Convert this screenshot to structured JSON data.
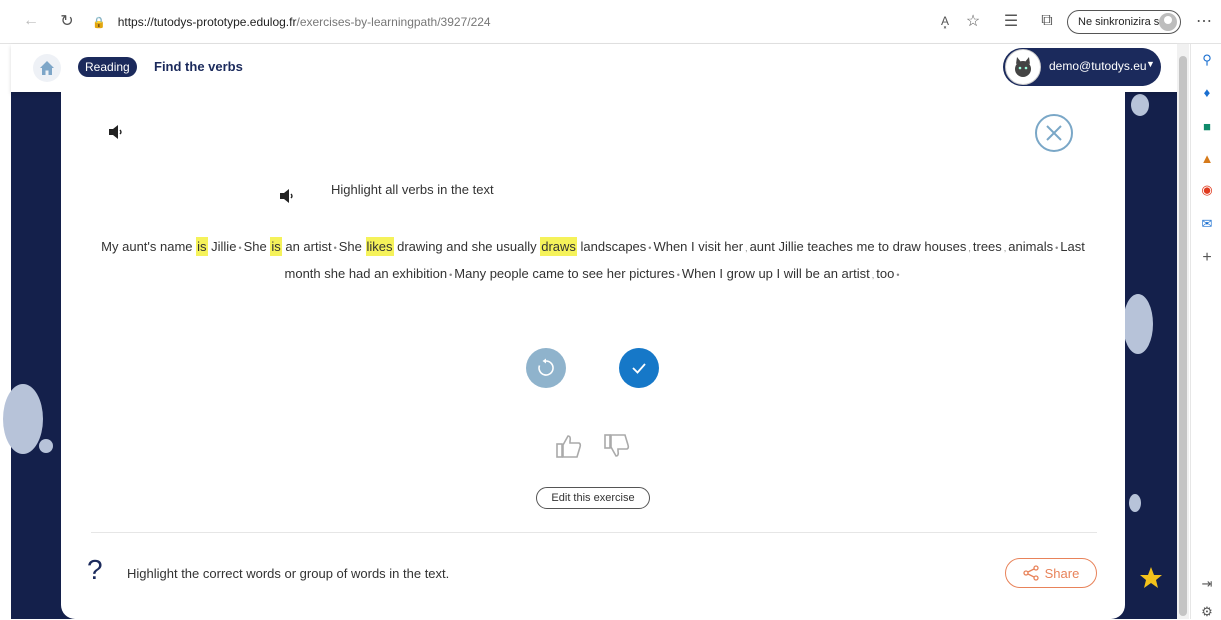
{
  "browser": {
    "url_host": "https://tutodys-prototype.edulog.fr",
    "url_path": "/exercises-by-learningpath/3927/224",
    "sync_label": "Ne sinkronizira se",
    "reader_mode_label": "A͓"
  },
  "header": {
    "category": "Reading",
    "title": "Find the verbs",
    "user_email": "demo@tutodys.eu"
  },
  "exercise": {
    "instruction": "Highlight all verbs in the text",
    "passage_line1": [
      {
        "t": "My aunt's name "
      },
      {
        "t": "is",
        "hl": true
      },
      {
        "t": " Jillie"
      },
      {
        "sep": "•"
      },
      {
        "t": "She "
      },
      {
        "t": "is",
        "hl": true
      },
      {
        "t": " an artist"
      },
      {
        "sep": "•"
      },
      {
        "t": "She "
      },
      {
        "t": "likes",
        "hl": true
      },
      {
        "t": " drawing and she usually "
      },
      {
        "t": "draws",
        "hl": true
      },
      {
        "t": " landscapes"
      },
      {
        "sep": "•"
      },
      {
        "t": "When I visit her"
      },
      {
        "sep": ","
      },
      {
        "t": "aunt Jillie teaches me to draw houses"
      },
      {
        "sep": ","
      },
      {
        "t": "trees"
      },
      {
        "sep": ","
      },
      {
        "t": "animals"
      },
      {
        "sep": "•"
      },
      {
        "t": "Last"
      }
    ],
    "passage_line2": [
      {
        "t": "month she had an exhibition"
      },
      {
        "sep": "•"
      },
      {
        "t": "Many people came to see her pictures"
      },
      {
        "sep": "•"
      },
      {
        "t": "When I grow up I will be an artist"
      },
      {
        "sep": ","
      },
      {
        "t": "too"
      },
      {
        "sep": "•"
      }
    ],
    "edit_label": "Edit this exercise"
  },
  "footer": {
    "help_mark": "?",
    "help_text": "Highlight the correct words or group of words in the text.",
    "share_label": "Share"
  },
  "colors": {
    "navy": "#1b2a5c",
    "highlight": "#f5f25a",
    "check_blue": "#1678c8",
    "share_orange": "#e8835a"
  }
}
